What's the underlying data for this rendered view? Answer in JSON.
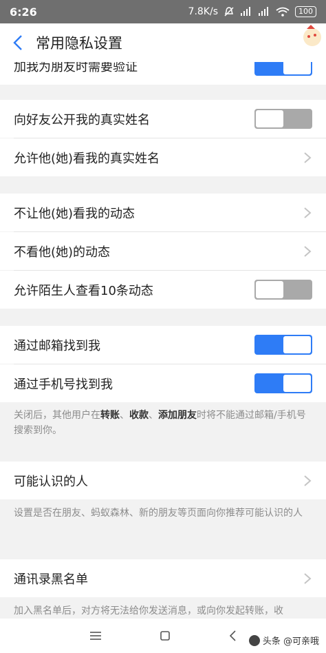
{
  "status": {
    "time": "6:26",
    "speed": "7.8K/s",
    "battery": "100"
  },
  "header": {
    "title": "常用隐私设置"
  },
  "rows": {
    "verify": {
      "label": "加我为朋友时需要验证",
      "state": "on"
    },
    "show_real_name": {
      "label": "向好友公开我的真实姓名",
      "state": "off"
    },
    "allow_view_real_name": {
      "label": "允许他(她)看我的真实姓名"
    },
    "hide_my_moments": {
      "label": "不让他(她)看我的动态"
    },
    "hide_their_moments": {
      "label": "不看他(她)的动态"
    },
    "stranger_view10": {
      "label": "允许陌生人查看10条动态",
      "state": "off"
    },
    "find_by_email": {
      "label": "通过邮箱找到我",
      "state": "on"
    },
    "find_by_phone": {
      "label": "通过手机号找到我",
      "state": "on"
    },
    "may_know": {
      "label": "可能认识的人"
    },
    "blacklist": {
      "label": "通讯录黑名单"
    }
  },
  "notes": {
    "find_pre": "关闭后，其他用户在",
    "find_b1": "转账",
    "find_sep1": "、",
    "find_b2": "收款",
    "find_sep2": "、",
    "find_b3": "添加朋友",
    "find_post": "时将不能通过邮箱/手机号搜索到你。",
    "may_know": "设置是否在朋友、蚂蚁森林、新的朋友等页面向你推荐可能认识的人",
    "blacklist": "加入黑名单后，对方将无法给你发送消息，或向你发起转账，收"
  },
  "watermark": {
    "text": "头条 @可亲哦"
  },
  "colors": {
    "accent": "#2e7cf6",
    "toggle_off": "#a9a9a9",
    "background": "#f2f2f2"
  }
}
